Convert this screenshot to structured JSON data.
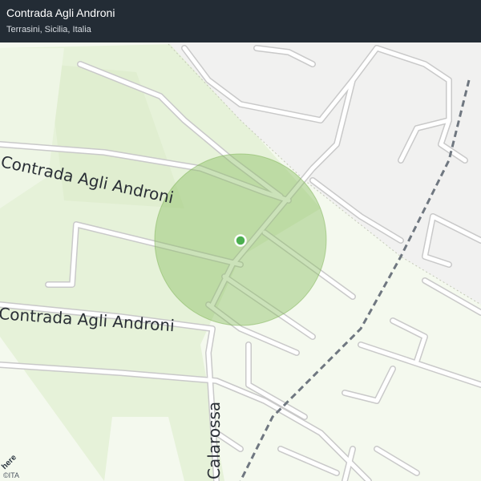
{
  "header": {
    "title": "Contrada Agli Androni",
    "subtitle": "Terrasini, Sicilia, Italia"
  },
  "map": {
    "road_labels": {
      "upper": "Contrada Agli Androni",
      "lower": "Contrada Agli Androni",
      "vertical": "Calarossa"
    },
    "logo_text": "here",
    "attribution": "©ITA",
    "colors": {
      "background": "#f4f9ee",
      "green_area": "#e6f2d9",
      "urban_area": "#f1f1f0",
      "road_casing": "#c9c9c9",
      "road_fill": "#ffffff",
      "rail": "#6f7780",
      "radius_fill": "#8cbf63",
      "marker": "#4caf50"
    }
  }
}
